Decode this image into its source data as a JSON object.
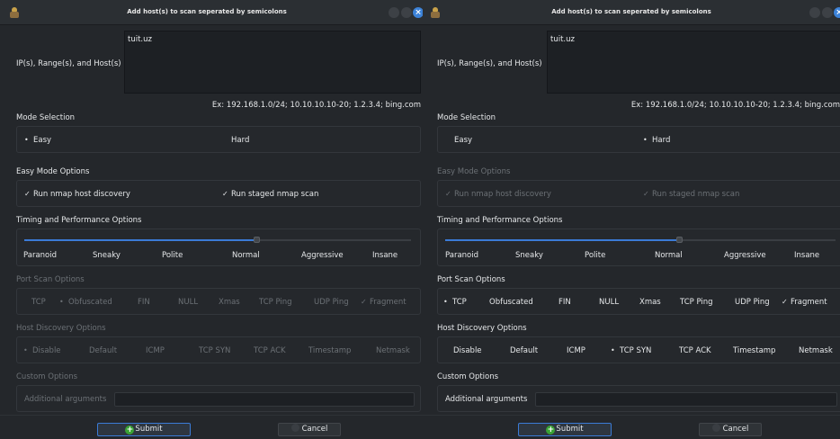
{
  "window_title": "Add host(s) to scan seperated by semicolons",
  "hosts_label": "IP(s), Range(s), and Host(s)",
  "example_text": "Ex: 192.168.1.0/24; 10.10.10.10-20; 1.2.3.4; bing.com",
  "section_mode": "Mode Selection",
  "section_easy": "Easy Mode Options",
  "section_timing": "Timing and Performance Options",
  "section_port": "Port Scan Options",
  "section_host": "Host Discovery Options",
  "section_custom": "Custom Options",
  "additional_args_label": "Additional arguments",
  "submit_label": "Submit",
  "cancel_label": "Cancel",
  "colors": {
    "accent": "#3b7bd6",
    "background": "#24272b",
    "submit_icon": "#3aa335"
  },
  "left": {
    "hosts_value": "tuit.uz",
    "mode": {
      "easy": "Easy",
      "hard": "Hard",
      "selected": "Easy"
    },
    "easy_options": {
      "discovery": "Run nmap host discovery",
      "staged": "Run staged nmap scan",
      "enabled": true,
      "discovery_checked": true,
      "staged_checked": true
    },
    "timing": {
      "labels": [
        "Paranoid",
        "Sneaky",
        "Polite",
        "Normal",
        "Aggressive",
        "Insane"
      ],
      "selected": "Normal",
      "level_fraction": 0.6
    },
    "port_scan": {
      "options": [
        "TCP",
        "Obfuscated",
        "FIN",
        "NULL",
        "Xmas",
        "TCP Ping",
        "UDP Ping",
        "Fragment"
      ],
      "selected": "Obfuscated",
      "checked": [
        "Fragment"
      ],
      "enabled": false
    },
    "host_discovery": {
      "options": [
        "Disable",
        "Default",
        "ICMP",
        "TCP SYN",
        "TCP ACK",
        "Timestamp",
        "Netmask"
      ],
      "selected": "Disable",
      "enabled": false
    },
    "custom_enabled": false
  },
  "right": {
    "hosts_value": "tuit.uz",
    "mode": {
      "easy": "Easy",
      "hard": "Hard",
      "selected": "Hard"
    },
    "easy_options": {
      "discovery": "Run nmap host discovery",
      "staged": "Run staged nmap scan",
      "enabled": false,
      "discovery_checked": true,
      "staged_checked": true
    },
    "timing": {
      "labels": [
        "Paranoid",
        "Sneaky",
        "Polite",
        "Normal",
        "Aggressive",
        "Insane"
      ],
      "selected": "Normal",
      "level_fraction": 0.6
    },
    "port_scan": {
      "options": [
        "TCP",
        "Obfuscated",
        "FIN",
        "NULL",
        "Xmas",
        "TCP Ping",
        "UDP Ping",
        "Fragment"
      ],
      "selected": "TCP",
      "checked": [
        "Fragment"
      ],
      "enabled": true
    },
    "host_discovery": {
      "options": [
        "Disable",
        "Default",
        "ICMP",
        "TCP SYN",
        "TCP ACK",
        "Timestamp",
        "Netmask"
      ],
      "selected": "TCP SYN",
      "enabled": true
    },
    "custom_enabled": true
  }
}
